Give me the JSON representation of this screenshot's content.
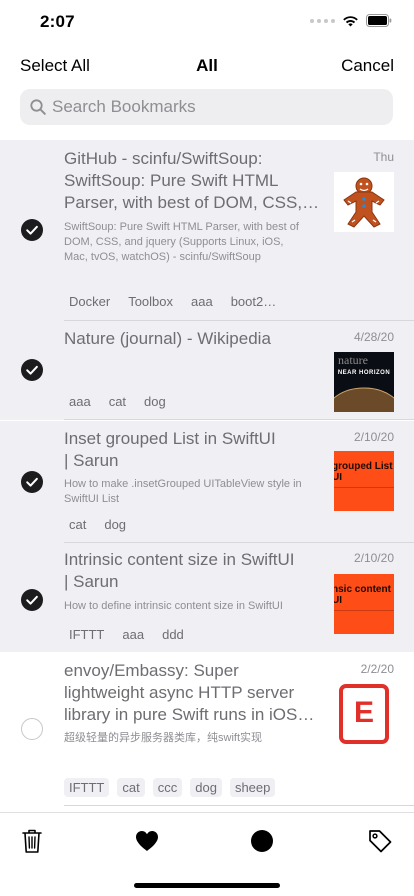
{
  "status_bar": {
    "time": "2:07"
  },
  "nav": {
    "left_label": "Select All",
    "title": "All",
    "right_label": "Cancel"
  },
  "search": {
    "placeholder": "Search Bookmarks"
  },
  "rows": [
    {
      "selected": true,
      "title_lines": [
        "GitHub - scinfu/SwiftSoup:",
        "SwiftSoup: Pure Swift HTML",
        "Parser, with best of DOM, CSS,…"
      ],
      "description_lines": [
        "SwiftSoup: Pure Swift HTML Parser, with best of",
        "DOM, CSS, and jquery (Supports Linux, iOS,",
        "Mac, tvOS, watchOS) - scinfu/SwiftSoup"
      ],
      "date": "Thu",
      "thumbnail": "gingerbread-man-icon",
      "tags": [
        "Docker",
        "Toolbox",
        "aaa",
        "boot2…"
      ]
    },
    {
      "selected": true,
      "title_lines": [
        "Nature (journal) - Wikipedia"
      ],
      "description_lines": [],
      "date": "4/28/20",
      "thumbnail": "nature-cover",
      "thumbnail_text": [
        "nature",
        "NEAR HORIZON"
      ],
      "tags": [
        "aaa",
        "cat",
        "dog"
      ]
    },
    {
      "selected": true,
      "title_lines": [
        "Inset grouped List in SwiftUI",
        "| Sarun"
      ],
      "description_lines": [
        "How to make .insetGrouped UITableView style in",
        "SwiftUI List"
      ],
      "date": "2/10/20",
      "thumbnail": "sarun-card",
      "thumbnail_text": [
        "grouped List in",
        "UI"
      ],
      "tags": [
        "cat",
        "dog"
      ]
    },
    {
      "selected": true,
      "title_lines": [
        "Intrinsic content size in SwiftUI",
        "| Sarun"
      ],
      "description_lines": [
        "How to define intrinsic content size in SwiftUI"
      ],
      "date": "2/10/20",
      "thumbnail": "sarun-card",
      "thumbnail_text": [
        "nsic content siz",
        "UI"
      ],
      "tags": [
        "IFTTT",
        "aaa",
        "ddd"
      ]
    },
    {
      "selected": false,
      "title_lines": [
        "envoy/Embassy: Super",
        "lightweight async HTTP server",
        "library in pure Swift runs in iOS…"
      ],
      "description_lines": [
        "超级轻量的异步服务器类库，纯swift实现"
      ],
      "date": "2/2/20",
      "thumbnail": "embassy-logo",
      "thumbnail_text": [
        "E"
      ],
      "tags": [
        "IFTTT",
        "cat",
        "ccc",
        "dog",
        "sheep"
      ]
    }
  ],
  "toolbar": {
    "items": [
      "trash-icon",
      "heart-icon",
      "circle-icon",
      "tag-icon"
    ]
  },
  "colors": {
    "selected_row": "#efeff4",
    "accent_dark": "#1c1c1e",
    "thumbnail_orange": "#ff4d18",
    "embassy_red": "#e1302a"
  }
}
